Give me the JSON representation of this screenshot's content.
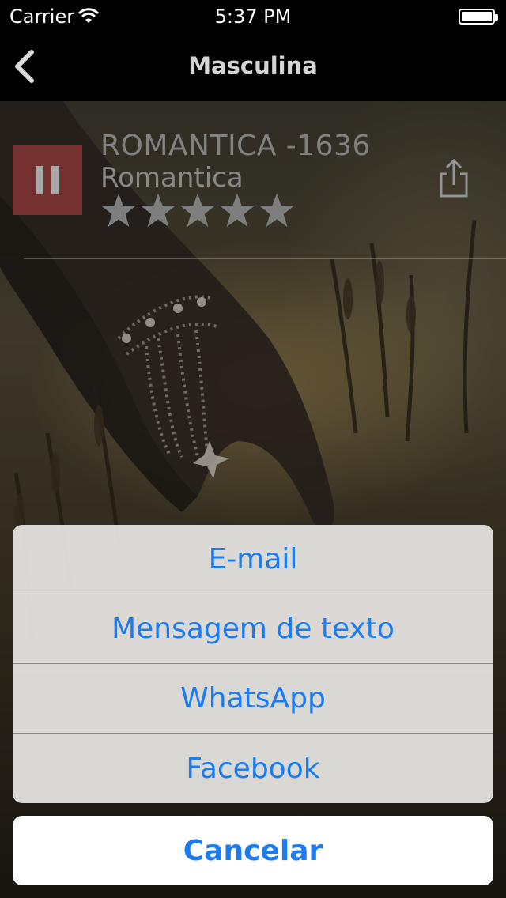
{
  "status_bar": {
    "carrier": "Carrier",
    "time": "5:37 PM"
  },
  "nav": {
    "title": "Masculina",
    "back_icon": "chevron-left-icon"
  },
  "player": {
    "state_icon": "pause-icon",
    "accent_color": "#8f3b3b",
    "track_title": "ROMANTICA -1636",
    "track_genre": "Romantica",
    "rating": {
      "value": 0,
      "max": 5
    },
    "share_icon": "share-icon"
  },
  "share_sheet": {
    "options": [
      {
        "label": "E-mail"
      },
      {
        "label": "Mensagem de texto"
      },
      {
        "label": "WhatsApp"
      },
      {
        "label": "Facebook"
      }
    ],
    "cancel_label": "Cancelar",
    "accent_color": "#1a7cf0"
  }
}
